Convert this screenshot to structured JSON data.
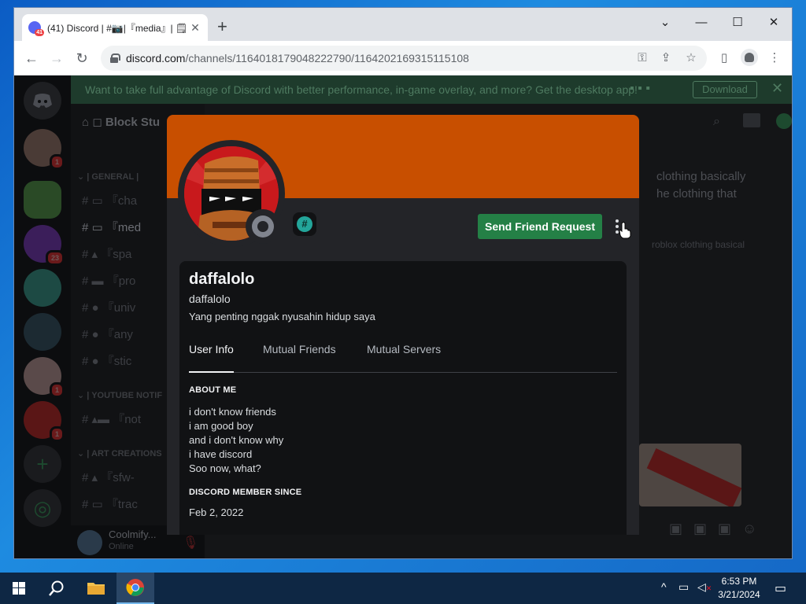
{
  "browser": {
    "tab_title": "(41) Discord | #📷|『media』| 🗒",
    "tab_badge": "41",
    "url_host": "discord.com",
    "url_path": "/channels/1164018179048222790/1164202169315115108"
  },
  "notice": {
    "text": "Want to take full advantage of Discord with better performance, in-game overlay, and more? Get the desktop app!",
    "download_label": "Download"
  },
  "guilds": {
    "badges": [
      "1",
      "23",
      "1",
      "1"
    ]
  },
  "sidebar": {
    "server_name": "Block Stu",
    "categories": [
      "GENERAL",
      "YOUTUBE NOTIF",
      "ART CREATIONS"
    ],
    "channels": [
      "『cha",
      "『med",
      "『spa",
      "『pro",
      "『univ",
      "『any",
      "『stic",
      "『not",
      "『sfw-",
      "『trac"
    ],
    "user_name": "Coolmify...",
    "user_status": "Online"
  },
  "chat": {
    "line1": "clothing basically",
    "line2": "he clothing that",
    "line3": "roblox clothing basical"
  },
  "profile": {
    "button_label": "Send Friend Request",
    "display_name": "daffalolo",
    "username": "daffalolo",
    "custom_status": "Yang penting nggak nyusahin hidup saya",
    "tabs": [
      "User Info",
      "Mutual Friends",
      "Mutual Servers"
    ],
    "about_heading": "ABOUT ME",
    "about_lines": [
      "i don't know friends",
      "i am good boy",
      "and i don't know why",
      "i have discord",
      "Soo now, what?"
    ],
    "member_since_heading": "DISCORD MEMBER SINCE",
    "member_since": "Feb 2, 2022",
    "colors": {
      "banner": "#c84f00",
      "button": "#248046"
    }
  },
  "taskbar": {
    "time": "6:53 PM",
    "date": "3/21/2024"
  }
}
